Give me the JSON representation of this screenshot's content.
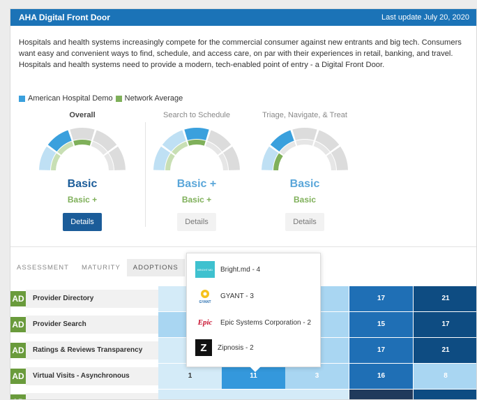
{
  "header": {
    "title": "AHA Digital Front Door",
    "last_update": "Last update July 20, 2020"
  },
  "description": "Hospitals and health systems increasingly compete for the commercial consumer against new entrants and big tech. Consumers want easy and convenient ways to find, schedule, and access care, on par with their experiences in retail, banking, and travel. Hospitals and health systems need to provide a modern, tech-enabled point of entry - a Digital Front Door.",
  "legend": [
    {
      "label": "American Hospital Demo",
      "color": "#3aa0dd"
    },
    {
      "label": "Network Average",
      "color": "#7fb05a"
    }
  ],
  "gauges": [
    {
      "title": "Overall",
      "level": "Basic",
      "level_color": "#1b5c99",
      "network_level": "Basic +",
      "button": "Details",
      "org_segments": 2,
      "net_segments": 3
    },
    {
      "title": "Search to Schedule",
      "level": "Basic +",
      "level_color": "#5aa6d9",
      "network_level": "Basic +",
      "button": "Details",
      "org_segments": 3,
      "net_segments": 3
    },
    {
      "title": "Triage, Navigate, & Treat",
      "level": "Basic",
      "level_color": "#5aa6d9",
      "network_level": "Basic",
      "button": "Details",
      "org_segments": 2,
      "net_segments": 1
    }
  ],
  "tabs": [
    "ASSESSMENT",
    "MATURITY",
    "ADOPTIONS"
  ],
  "active_tab": "ADOPTIONS",
  "rows": [
    {
      "badge": "AD",
      "label": "Provider Directory",
      "cells": [
        {
          "text": "",
          "color": "#d4ebf8"
        },
        {
          "text": "",
          "color": "#a9d6f2"
        },
        {
          "text": "",
          "color": "#a9d6f2"
        },
        {
          "text": "17",
          "color": "#1f6fb5"
        },
        {
          "text": "21",
          "color": "#0e4c82"
        }
      ]
    },
    {
      "badge": "AD",
      "label": "Provider Search",
      "cells": [
        {
          "text": "",
          "color": "#a9d6f2"
        },
        {
          "text": "",
          "color": "#a9d6f2"
        },
        {
          "text": "",
          "color": "#a9d6f2"
        },
        {
          "text": "15",
          "color": "#1f6fb5"
        },
        {
          "text": "17",
          "color": "#0e4c82"
        }
      ]
    },
    {
      "badge": "AD",
      "label": "Ratings & Reviews Transparency",
      "cells": [
        {
          "text": "",
          "color": "#d4ebf8"
        },
        {
          "text": "",
          "color": "#a9d6f2"
        },
        {
          "text": "",
          "color": "#a9d6f2"
        },
        {
          "text": "17",
          "color": "#1f6fb5"
        },
        {
          "text": "21",
          "color": "#0e4c82"
        }
      ]
    },
    {
      "badge": "AD",
      "label": "Virtual Visits - Asynchronous",
      "cells": [
        {
          "text": "1",
          "color": "#d4ebf8",
          "dark": true
        },
        {
          "text": "11",
          "color": "#3498dc"
        },
        {
          "text": "3",
          "color": "#a9d6f2"
        },
        {
          "text": "16",
          "color": "#1f6fb5"
        },
        {
          "text": "8",
          "color": "#a9d6f2"
        }
      ]
    },
    {
      "badge": "AD",
      "label": "",
      "cells": [
        {
          "text": "",
          "color": "#d4ebf8"
        },
        {
          "text": "",
          "color": "#d4ebf8"
        },
        {
          "text": "",
          "color": "#d4ebf8"
        },
        {
          "text": "",
          "color": "#203a5c"
        },
        {
          "text": "",
          "color": "#0e4c82"
        }
      ]
    }
  ],
  "popup": [
    {
      "label": "Bright.md - 4",
      "logo": "bright-md-logo",
      "logo_text": "BRIGHT.MD"
    },
    {
      "label": "GYANT - 3",
      "logo": "gyant-logo",
      "logo_text": "GYANT"
    },
    {
      "label": "Epic Systems Corporation - 2",
      "logo": "epic-logo",
      "logo_text": "Epic"
    },
    {
      "label": "Zipnosis - 2",
      "logo": "zipnosis-logo",
      "logo_text": "Z"
    }
  ]
}
